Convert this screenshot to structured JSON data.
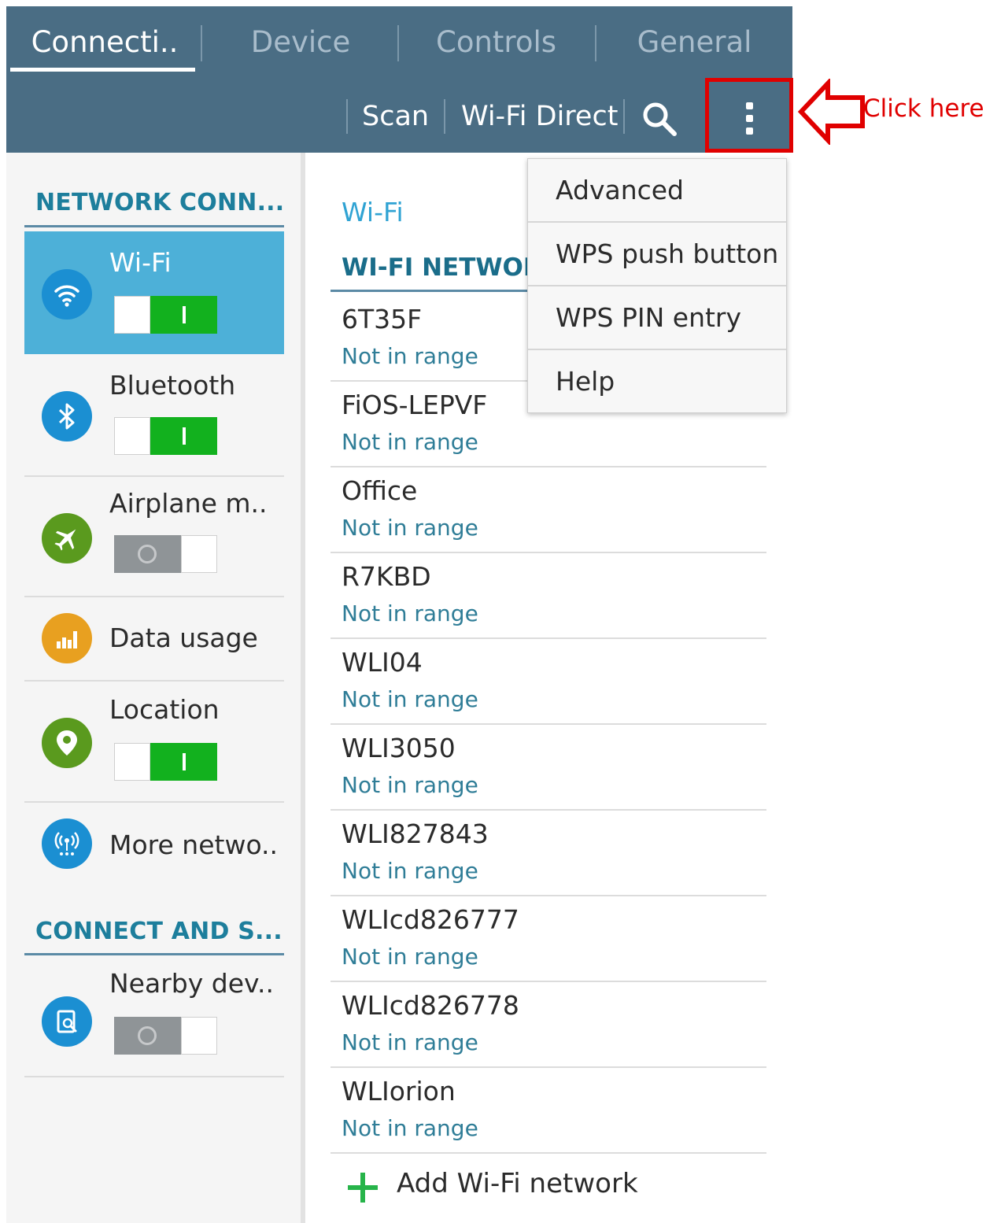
{
  "tabs": [
    {
      "label": "Connecti..",
      "active": true
    },
    {
      "label": "Device",
      "active": false
    },
    {
      "label": "Controls",
      "active": false
    },
    {
      "label": "General",
      "active": false
    }
  ],
  "actions": {
    "scan": "Scan",
    "wifi_direct": "Wi-Fi Direct",
    "search_icon": "search-icon",
    "more_icon": "more-vert-icon"
  },
  "sidebar": {
    "section1": "NETWORK CONN...",
    "section2": "CONNECT AND S...",
    "items": [
      {
        "label": "Wi-Fi",
        "icon": "wifi-icon",
        "color": "#1b8fd2",
        "toggle": "on",
        "selected": true
      },
      {
        "label": "Bluetooth",
        "icon": "bluetooth-icon",
        "color": "#1b8fd2",
        "toggle": "on"
      },
      {
        "label": "Airplane m..",
        "icon": "airplane-icon",
        "color": "#5a9a1e",
        "toggle": "off"
      },
      {
        "label": "Data usage",
        "icon": "data-usage-icon",
        "color": "#e8a020"
      },
      {
        "label": "Location",
        "icon": "location-icon",
        "color": "#5a9a1e",
        "toggle": "on"
      },
      {
        "label": "More netwo..",
        "icon": "more-networks-icon",
        "color": "#1b8fd2"
      },
      {
        "label": "Nearby dev..",
        "icon": "nearby-devices-icon",
        "color": "#1b8fd2",
        "toggle": "off"
      }
    ]
  },
  "main": {
    "title": "Wi-Fi",
    "section": "WI-FI NETWORKS",
    "networks": [
      {
        "ssid": "6T35F",
        "status": "Not in range"
      },
      {
        "ssid": "FiOS-LEPVF",
        "status": "Not in range"
      },
      {
        "ssid": "Office",
        "status": "Not in range"
      },
      {
        "ssid": "R7KBD",
        "status": "Not in range"
      },
      {
        "ssid": "WLI04",
        "status": "Not in range"
      },
      {
        "ssid": "WLI3050",
        "status": "Not in range"
      },
      {
        "ssid": "WLI827843",
        "status": "Not in range"
      },
      {
        "ssid": "WLIcd826777",
        "status": "Not in range"
      },
      {
        "ssid": "WLIcd826778",
        "status": "Not in range"
      },
      {
        "ssid": "WLIorion",
        "status": "Not in range"
      }
    ],
    "add_network": "Add Wi-Fi network"
  },
  "menu": {
    "items": [
      "Advanced",
      "WPS push button",
      "WPS PIN entry",
      "Help"
    ]
  },
  "annotation": {
    "text": "Click here",
    "color": "#e00000"
  },
  "colors": {
    "header": "#4a6d84",
    "selected_item": "#4db0d8",
    "toggle_on": "#12b11e",
    "section_text": "#1d7e9c"
  }
}
